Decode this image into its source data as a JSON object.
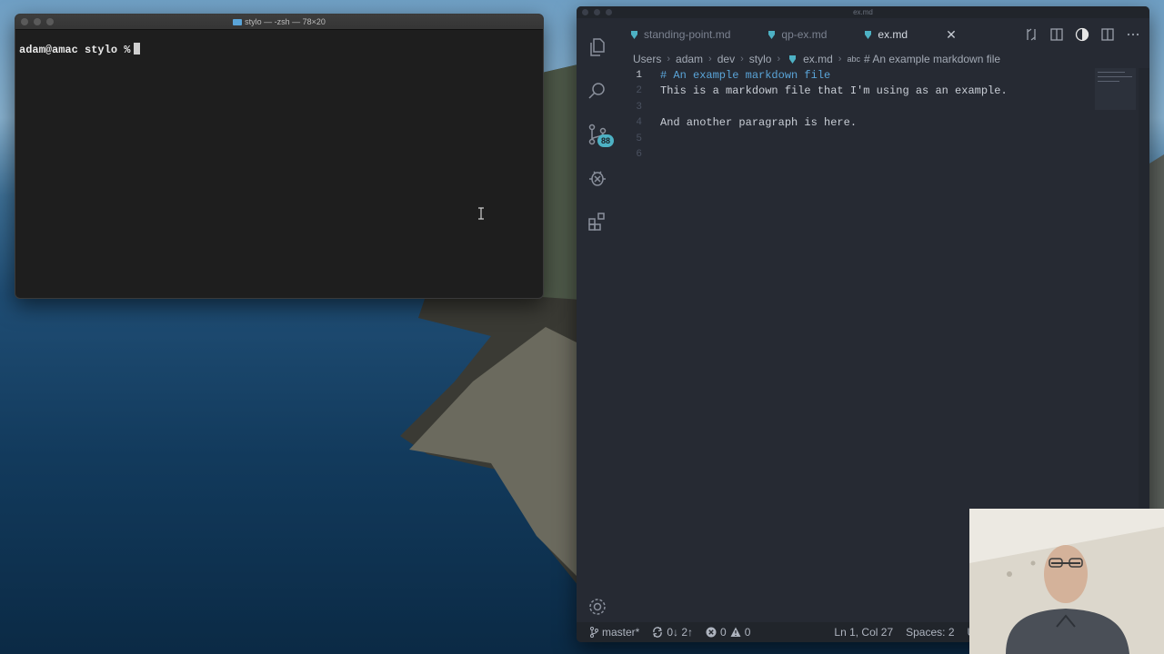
{
  "terminal": {
    "title": "stylo — -zsh — 78×20",
    "prompt": "adam@amac stylo %"
  },
  "vscode": {
    "window_title": "ex.md",
    "tabs": [
      {
        "label": "standing-point.md",
        "active": false
      },
      {
        "label": "qp-ex.md",
        "active": false
      },
      {
        "label": "ex.md",
        "active": true
      }
    ],
    "close_glyph": "✕",
    "breadcrumb": [
      "Users",
      "adam",
      "dev",
      "stylo",
      "ex.md"
    ],
    "breadcrumb_symbol": "abc",
    "breadcrumb_heading": "# An example markdown file",
    "source_control_badge": "88",
    "lines": [
      {
        "num": "1",
        "text": "# An example markdown file"
      },
      {
        "num": "2",
        "text": "This is a markdown file that I'm using as an example."
      },
      {
        "num": "3",
        "text": ""
      },
      {
        "num": "4",
        "text": "And another paragraph is here."
      },
      {
        "num": "5",
        "text": ""
      },
      {
        "num": "6",
        "text": ""
      }
    ],
    "status": {
      "branch": "master*",
      "sync": "0↓ 2↑",
      "errors": "0",
      "warnings": "0",
      "position": "Ln 1, Col 27",
      "spaces": "Spaces: 2",
      "encoding": "U"
    }
  },
  "colors": {
    "accent": "#4db1c4",
    "markdown_heading": "#5aa4d8",
    "editor_bg": "#262a33",
    "terminal_bg": "#1e1e1e"
  }
}
